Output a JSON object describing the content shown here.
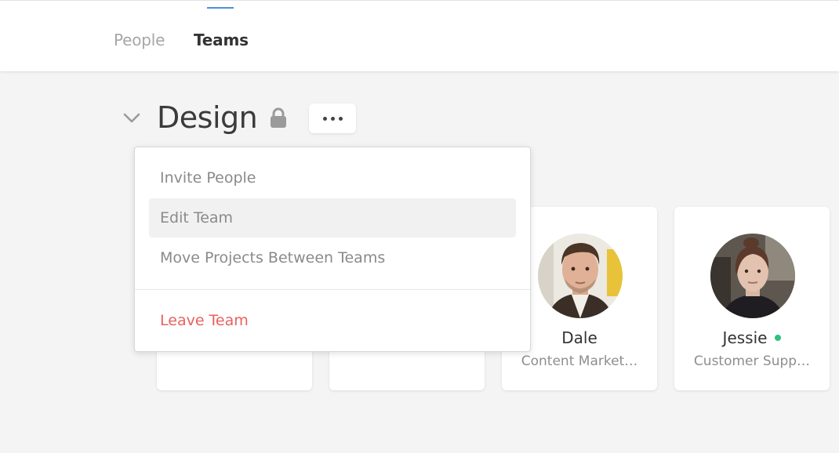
{
  "nav": {
    "tabs": [
      {
        "label": "People",
        "active": false
      },
      {
        "label": "Teams",
        "active": true
      }
    ],
    "accent_color": "#4a90d9"
  },
  "team": {
    "name": "Design",
    "locked": true,
    "icons": {
      "collapse": "chevron-down-icon",
      "lock": "lock-icon",
      "more": "more-horizontal-icon"
    }
  },
  "team_menu": {
    "items": [
      {
        "label": "Invite People"
      },
      {
        "label": "Edit Team",
        "hovered": true
      },
      {
        "label": "Move Projects Between Teams"
      }
    ],
    "danger_item": {
      "label": "Leave Team",
      "color": "#e8625c"
    }
  },
  "members": [
    {
      "name": "",
      "role": ""
    },
    {
      "name": "",
      "role": ""
    },
    {
      "name": "Dale",
      "role": "Content Market…",
      "online": false
    },
    {
      "name": "Jessie",
      "role": "Customer Supp…",
      "online": true,
      "status_color": "#2ec27e"
    }
  ]
}
